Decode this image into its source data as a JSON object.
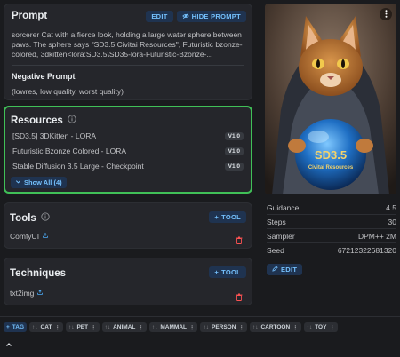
{
  "prompt": {
    "title": "Prompt",
    "edit_label": "EDIT",
    "hide_label": "HIDE PROMPT",
    "text": "sorcerer Cat with a fierce look, holding a large water sphere between paws. The sphere says \"SD3.5 Civitai Resources\", Futuristic bzonze-colored, 3dkitten<lora:SD3.5\\SD35-lora-Futuristic-Bzonze-...",
    "negative_title": "Negative Prompt",
    "negative_text": "(lowres, low quality, worst quality)"
  },
  "resources": {
    "title": "Resources",
    "items": [
      {
        "name": "[SD3.5] 3DKitten - LORA",
        "version": "V1.0"
      },
      {
        "name": "Futuristic Bzonze Colored - LORA",
        "version": "V1.0"
      },
      {
        "name": "Stable Diffusion 3.5 Large - Checkpoint",
        "version": "V1.0"
      }
    ],
    "show_all": "Show All (4)"
  },
  "tools": {
    "title": "Tools",
    "add_label": "TOOL",
    "items": [
      {
        "name": "ComfyUI"
      }
    ]
  },
  "techniques": {
    "title": "Techniques",
    "add_label": "TOOL",
    "items": [
      {
        "name": "txt2img"
      }
    ]
  },
  "image": {
    "sphere_line1": "SD3.5",
    "sphere_line2": "Civitai Resources"
  },
  "generation": {
    "rows": [
      {
        "label": "Guidance",
        "value": "4.5"
      },
      {
        "label": "Steps",
        "value": "30"
      },
      {
        "label": "Sampler",
        "value": "DPM++ 2M"
      },
      {
        "label": "Seed",
        "value": "67212322681320"
      }
    ],
    "edit_label": "EDIT"
  },
  "tags": {
    "add_label": "TAG",
    "items": [
      "CAT",
      "PET",
      "ANIMAL",
      "MAMMAL",
      "PERSON",
      "CARTOON",
      "TOY"
    ]
  },
  "colors": {
    "accent": "#4dabf7",
    "highlight_border": "#40c057",
    "card": "#25262b",
    "background": "#1a1b1e"
  }
}
